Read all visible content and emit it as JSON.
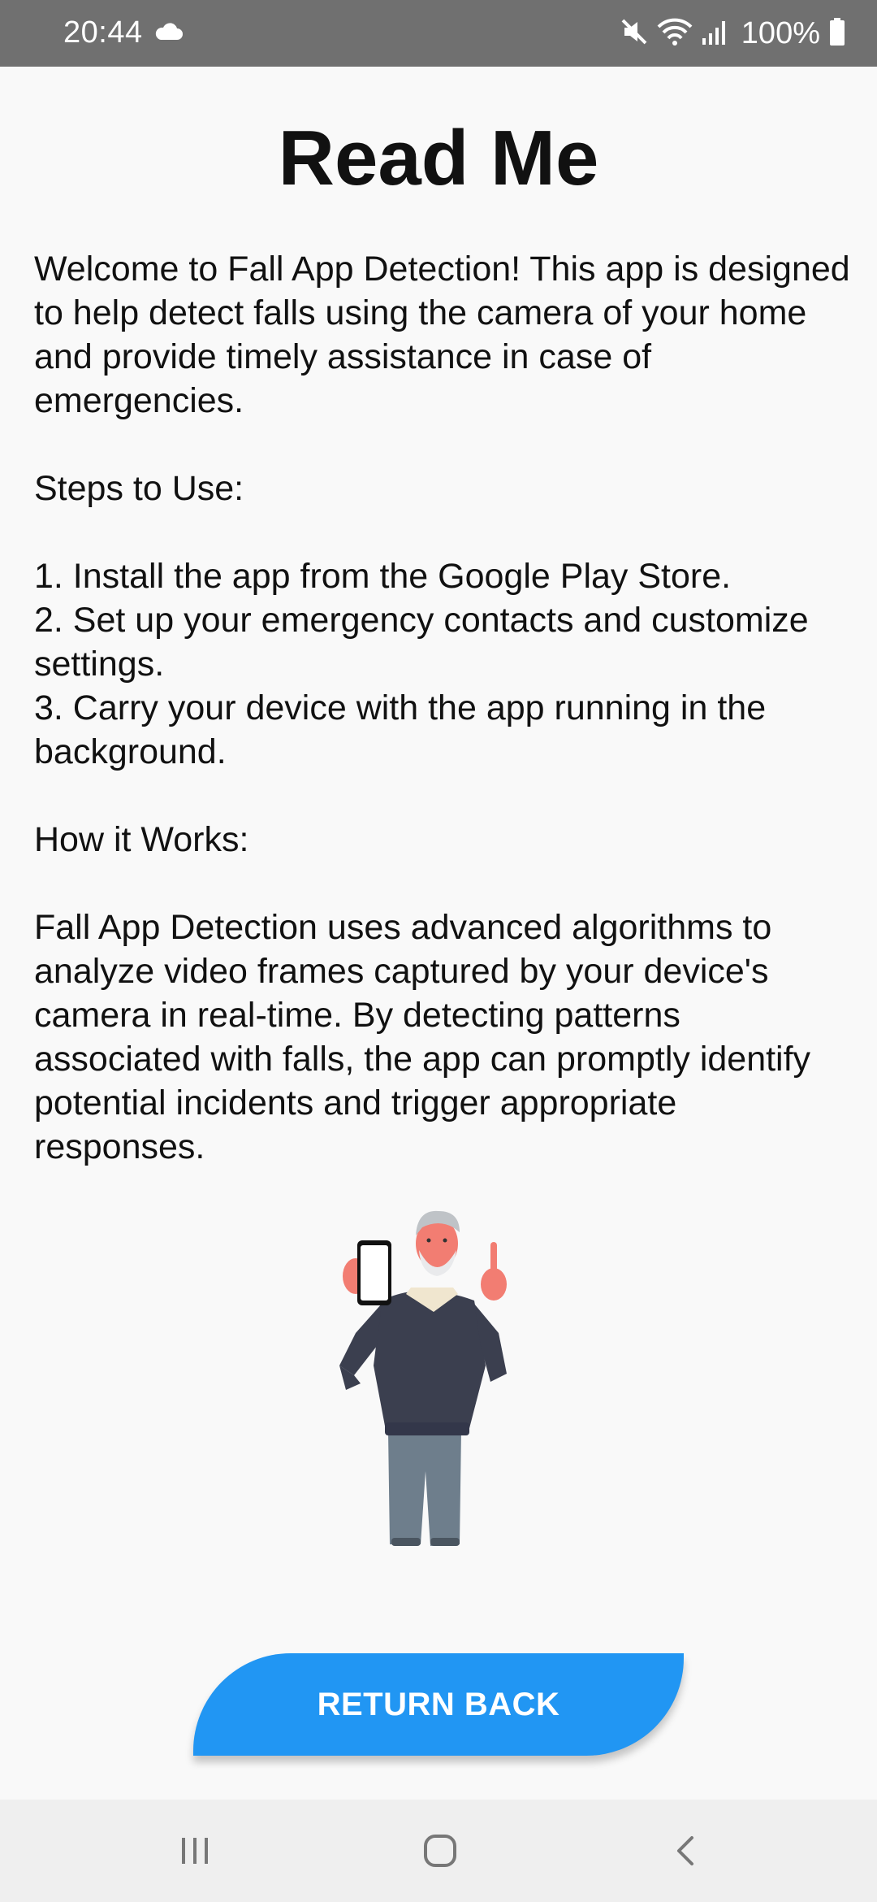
{
  "status_bar": {
    "time": "20:44",
    "battery": "100%",
    "icons": [
      "cloud-icon",
      "mute-icon",
      "wifi-icon",
      "signal-icon",
      "battery-icon"
    ]
  },
  "page": {
    "title": "Read Me",
    "intro": "Welcome to Fall App Detection! This app is designed to help detect falls using the camera of your home and provide timely assistance in case of emergencies.",
    "steps_heading": "Steps to Use:",
    "steps": [
      "1. Install the app from the Google Play Store.",
      "2. Set up your emergency contacts and customize settings.",
      "3. Carry your device with the app running in the background."
    ],
    "how_heading": "How it Works:",
    "how_text": "Fall App Detection uses advanced algorithms to analyze video frames captured by your device's camera in real-time. By detecting patterns associated with falls, the app can promptly identify potential incidents and trigger appropriate responses.",
    "illustration": "elderly-man-with-phone-illustration",
    "button_label": "RETURN BACK"
  },
  "colors": {
    "status_bar": "#707070",
    "background": "#f9f9f9",
    "accent": "#2196f3",
    "nav_bar": "#efefef"
  },
  "nav_bar": {
    "icons": [
      "recent-apps-icon",
      "home-icon",
      "back-icon"
    ]
  }
}
